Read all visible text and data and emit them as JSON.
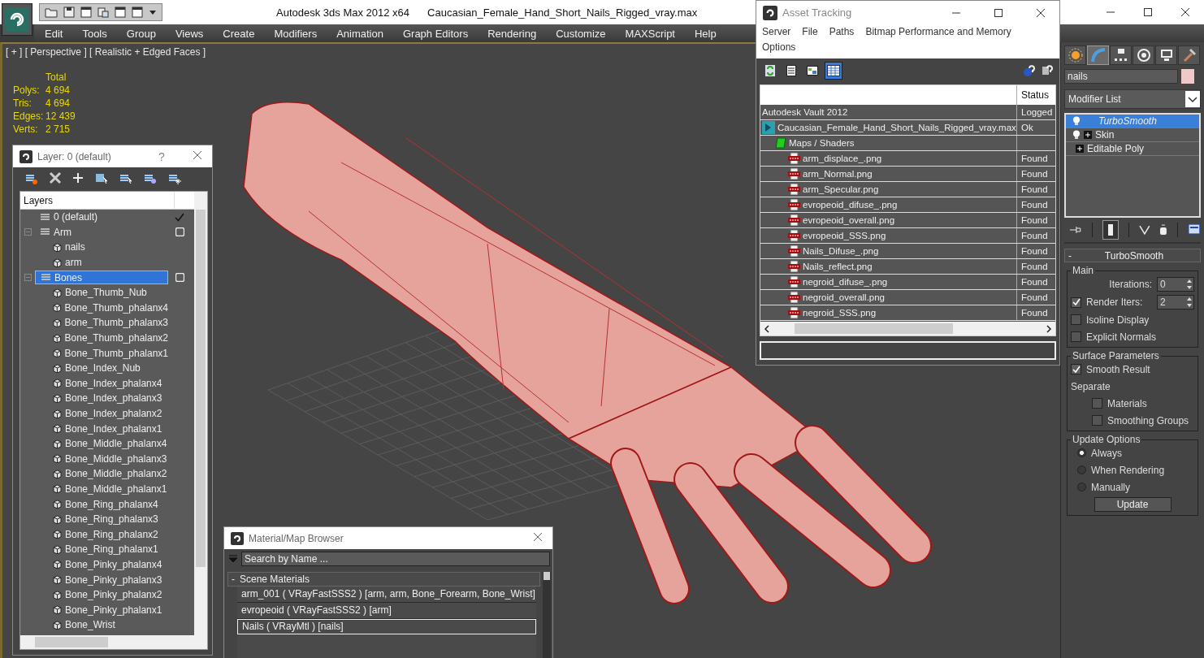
{
  "title_bar": {
    "app": "Autodesk 3ds Max  2012 x64",
    "file": "Caucasian_Female_Hand_Short_Nails_Rigged_vray.max"
  },
  "menu": [
    "Edit",
    "Tools",
    "Group",
    "Views",
    "Create",
    "Modifiers",
    "Animation",
    "Graph Editors",
    "Rendering",
    "Customize",
    "MAXScript",
    "Help"
  ],
  "viewport": {
    "label": "[ + ] [ Perspective ] [ Realistic + Edged Faces ]",
    "stats_header": "Total",
    "stats": [
      {
        "label": "Polys:",
        "value": "4 694"
      },
      {
        "label": "Tris:",
        "value": "4 694"
      },
      {
        "label": "Edges:",
        "value": "12 439"
      },
      {
        "label": "Verts:",
        "value": "2 715"
      }
    ]
  },
  "layer_window": {
    "title": "Layer: 0 (default)",
    "help": "?",
    "column": "Layers",
    "layers": [
      {
        "name": "0 (default)",
        "kind": "layer",
        "current": true,
        "selected": false
      },
      {
        "name": "Arm",
        "kind": "layer",
        "current": false,
        "selected": false,
        "expanded": true,
        "children": [
          {
            "name": "nails",
            "kind": "object",
            "selected": false
          },
          {
            "name": "arm",
            "kind": "object",
            "selected": false
          }
        ]
      },
      {
        "name": "Bones",
        "kind": "layer",
        "current": false,
        "selected": true,
        "expanded": true,
        "children": [
          {
            "name": "Bone_Thumb_Nub",
            "kind": "object",
            "selected": false
          },
          {
            "name": "Bone_Thumb_phalanx4",
            "kind": "object",
            "selected": false
          },
          {
            "name": "Bone_Thumb_phalanx3",
            "kind": "object",
            "selected": false
          },
          {
            "name": "Bone_Thumb_phalanx2",
            "kind": "object",
            "selected": false
          },
          {
            "name": "Bone_Thumb_phalanx1",
            "kind": "object",
            "selected": false
          },
          {
            "name": "Bone_Index_Nub",
            "kind": "object",
            "selected": false
          },
          {
            "name": "Bone_Index_phalanx4",
            "kind": "object",
            "selected": false
          },
          {
            "name": "Bone_Index_phalanx3",
            "kind": "object",
            "selected": false
          },
          {
            "name": "Bone_Index_phalanx2",
            "kind": "object",
            "selected": false
          },
          {
            "name": "Bone_Index_phalanx1",
            "kind": "object",
            "selected": false
          },
          {
            "name": "Bone_Middle_phalanx4",
            "kind": "object",
            "selected": false
          },
          {
            "name": "Bone_Middle_phalanx3",
            "kind": "object",
            "selected": false
          },
          {
            "name": "Bone_Middle_phalanx2",
            "kind": "object",
            "selected": false
          },
          {
            "name": "Bone_Middle_phalanx1",
            "kind": "object",
            "selected": false
          },
          {
            "name": "Bone_Ring_phalanx4",
            "kind": "object",
            "selected": false
          },
          {
            "name": "Bone_Ring_phalanx3",
            "kind": "object",
            "selected": false
          },
          {
            "name": "Bone_Ring_phalanx2",
            "kind": "object",
            "selected": false
          },
          {
            "name": "Bone_Ring_phalanx1",
            "kind": "object",
            "selected": false
          },
          {
            "name": "Bone_Pinky_phalanx4",
            "kind": "object",
            "selected": false
          },
          {
            "name": "Bone_Pinky_phalanx3",
            "kind": "object",
            "selected": false
          },
          {
            "name": "Bone_Pinky_phalanx2",
            "kind": "object",
            "selected": false
          },
          {
            "name": "Bone_Pinky_phalanx1",
            "kind": "object",
            "selected": false
          },
          {
            "name": "Bone_Wrist",
            "kind": "object",
            "selected": false
          }
        ]
      }
    ]
  },
  "asset_window": {
    "title": "Asset Tracking",
    "menu": [
      "Server",
      "File",
      "Paths",
      "Bitmap Performance and Memory",
      "Options"
    ],
    "view_buttons": [
      {
        "selected": false
      },
      {
        "selected": false
      },
      {
        "selected": false
      },
      {
        "selected": true
      }
    ],
    "status_column": "Status",
    "rows": [
      {
        "name": "Autodesk Vault 2012",
        "kind": "vault",
        "status": "Logged"
      },
      {
        "name": "Caucasian_Female_Hand_Short_Nails_Rigged_vray.max",
        "kind": "scene",
        "status": "Ok",
        "children": [
          {
            "name": "Maps / Shaders",
            "kind": "folder",
            "children": [
              {
                "name": "arm_displace_.png",
                "kind": "png",
                "status": "Found"
              },
              {
                "name": "arm_Normal.png",
                "kind": "png",
                "status": "Found"
              },
              {
                "name": "arm_Specular.png",
                "kind": "png",
                "status": "Found"
              },
              {
                "name": "evropeoid_difuse_.png",
                "kind": "png",
                "status": "Found"
              },
              {
                "name": "evropeoid_overall.png",
                "kind": "png",
                "status": "Found"
              },
              {
                "name": "evropeoid_SSS.png",
                "kind": "png",
                "status": "Found"
              },
              {
                "name": "Nails_Difuse_.png",
                "kind": "png",
                "status": "Found"
              },
              {
                "name": "Nails_reflect.png",
                "kind": "png",
                "status": "Found"
              },
              {
                "name": "negroid_difuse_.png",
                "kind": "png",
                "status": "Found"
              },
              {
                "name": "negroid_overall.png",
                "kind": "png",
                "status": "Found"
              },
              {
                "name": "negroid_SSS.png",
                "kind": "png",
                "status": "Found"
              }
            ]
          }
        ]
      }
    ]
  },
  "material_browser": {
    "title": "Material/Map Browser",
    "search_placeholder": "Search by Name ...",
    "section_toggle": "-",
    "section": "Scene Materials",
    "items": [
      {
        "text": "arm_001  ( VRayFastSSS2 )  [arm, arm, Bone_Forearm, Bone_Wrist]",
        "selected": false
      },
      {
        "text": "evropeoid  ( VRayFastSSS2 )  [arm]",
        "selected": false
      },
      {
        "text": "Nails  ( VRayMtl )  [nails]",
        "selected": true
      }
    ]
  },
  "command_panel": {
    "tabs": [
      {
        "selected": false
      },
      {
        "selected": true
      },
      {
        "selected": false
      },
      {
        "selected": false
      },
      {
        "selected": false
      },
      {
        "selected": false
      }
    ],
    "object_name": "nails",
    "modifier_list": "Modifier List",
    "stack": [
      {
        "name": "TurboSmooth",
        "selected": true,
        "light": true,
        "expandable": false
      },
      {
        "name": "Skin",
        "selected": false,
        "light": true,
        "expandable": true
      },
      {
        "name": "Editable Poly",
        "selected": false,
        "light": false,
        "expandable": true
      }
    ],
    "rollout": {
      "toggle": "-",
      "title": "TurboSmooth",
      "groups": [
        {
          "title": "Main",
          "controls": [
            {
              "kind": "spinner",
              "label": "Iterations:",
              "value": "0"
            },
            {
              "kind": "check-spinner",
              "label": "Render Iters:",
              "checked": true,
              "value": "2"
            },
            {
              "kind": "checkbox",
              "label": "Isoline Display",
              "checked": false
            },
            {
              "kind": "checkbox",
              "label": "Explicit Normals",
              "checked": false
            }
          ]
        },
        {
          "title": "Surface Parameters",
          "controls": [
            {
              "kind": "checkbox",
              "label": "Smooth Result",
              "checked": true
            },
            {
              "kind": "text",
              "label": "Separate"
            },
            {
              "kind": "subcheckbox",
              "label": "Materials",
              "checked": false
            },
            {
              "kind": "subcheckbox",
              "label": "Smoothing Groups",
              "checked": false
            }
          ]
        },
        {
          "title": "Update Options",
          "controls": [
            {
              "kind": "radio",
              "label": "Always",
              "selected": true
            },
            {
              "kind": "radio",
              "label": "When Rendering",
              "selected": false
            },
            {
              "kind": "radio",
              "label": "Manually",
              "selected": false
            },
            {
              "kind": "button",
              "label": "Update"
            }
          ]
        }
      ]
    }
  }
}
